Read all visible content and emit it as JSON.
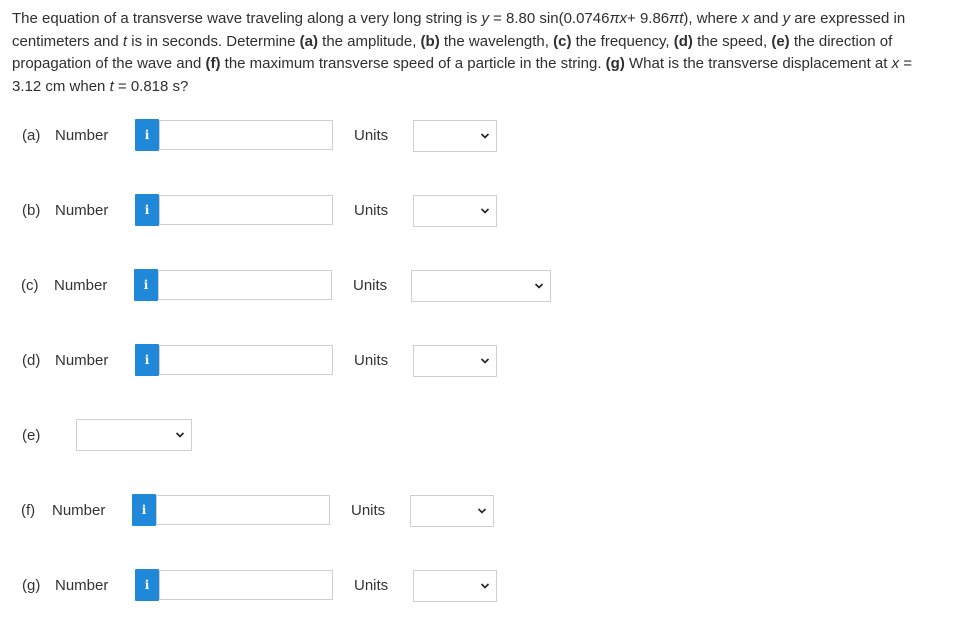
{
  "question": {
    "p1": "The equation of a transverse wave traveling along a very long string is ",
    "y": "y",
    "p2": " = 8.80 sin(0.0746",
    "pi1": "π",
    "x1": "x",
    "p3": "+ 9.86",
    "pi2": "π",
    "t1": "t",
    "p4": "), where ",
    "x2": "x",
    "p5": " and ",
    "y2": "y",
    "p6": " are expressed in centimeters and ",
    "t2": "t",
    "p7": " is in seconds. Determine ",
    "a": "(a)",
    "a_txt": " the amplitude, ",
    "b": "(b)",
    "b_txt": " the wavelength, ",
    "c": "(c)",
    "c_txt": " the frequency, ",
    "d": "(d)",
    "d_txt": " the speed, ",
    "e": "(e)",
    "e_txt": " the direction of propagation of the wave and ",
    "f": "(f)",
    "f_txt": " the maximum transverse speed of a particle in the string. ",
    "g": "(g)",
    "g_txt": " What is the transverse displacement at ",
    "x3": "x",
    "p8": " = 3.12 cm when ",
    "t3": "t",
    "p9": " = 0.818 s?"
  },
  "rows": [
    {
      "part": "(a)",
      "number_label": "Number",
      "units_label": "Units",
      "number_value": "",
      "unit_value": ""
    },
    {
      "part": "(b)",
      "number_label": "Number",
      "units_label": "Units",
      "number_value": "",
      "unit_value": ""
    },
    {
      "part": "(c)",
      "number_label": "Number",
      "units_label": "Units",
      "number_value": "",
      "unit_value": ""
    },
    {
      "part": "(d)",
      "number_label": "Number",
      "units_label": "Units",
      "number_value": "",
      "unit_value": ""
    },
    {
      "part": "(e)",
      "selected_value": ""
    },
    {
      "part": "(f)",
      "number_label": "Number",
      "units_label": "Units",
      "number_value": "",
      "unit_value": ""
    },
    {
      "part": "(g)",
      "number_label": "Number",
      "units_label": "Units",
      "number_value": "",
      "unit_value": ""
    }
  ],
  "info_glyph": "i",
  "colors": {
    "info_bg": "#1f88d8",
    "border": "#cfcfcf",
    "text": "#2f2f2f"
  }
}
